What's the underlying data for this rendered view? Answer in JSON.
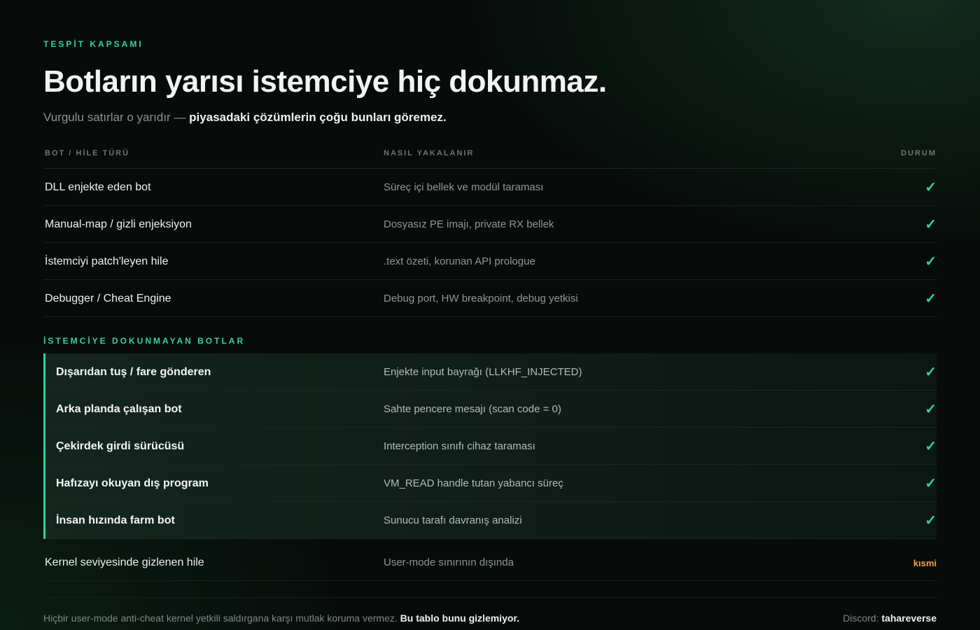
{
  "header": {
    "eyebrow": "TESPİT KAPSAMI",
    "title": "Botların yarısı istemciye hiç dokunmaz.",
    "subtitle_prefix": "Vurgulu satırlar o yarıdır — ",
    "subtitle_emphasis": "piyasadaki çözümlerin çoğu bunları göremez."
  },
  "table": {
    "headers": [
      "BOT / HİLE TÜRÜ",
      "NASIL YAKALANIR",
      "DURUM"
    ],
    "rows": [
      {
        "type": "DLL enjekte eden bot",
        "how": "Süreç içi bellek ve modül taraması",
        "status": "✓"
      },
      {
        "type": "Manual-map / gizli enjeksiyon",
        "how": "Dosyasız PE imajı, private RX bellek",
        "status": "✓"
      },
      {
        "type": "İstemciyi patch'leyen hile",
        "how": ".text özeti, korunan API prologue",
        "status": "✓"
      },
      {
        "type": "Debugger / Cheat Engine",
        "how": "Debug port, HW breakpoint, debug yetkisi",
        "status": "✓"
      }
    ],
    "section_label": "İSTEMCİYE DOKUNMAYAN BOTLAR",
    "highlight_rows": [
      {
        "type": "Dışarıdan tuş / fare gönderen",
        "how": "Enjekte input bayrağı (LLKHF_INJECTED)",
        "status": "✓"
      },
      {
        "type": "Arka planda çalışan bot",
        "how": "Sahte pencere mesajı (scan code = 0)",
        "status": "✓"
      },
      {
        "type": "Çekirdek girdi sürücüsü",
        "how": "Interception sınıfı cihaz taraması",
        "status": "✓"
      },
      {
        "type": "Hafızayı okuyan dış program",
        "how": "VM_READ handle tutan yabancı süreç",
        "status": "✓"
      },
      {
        "type": "İnsan hızında farm bot",
        "how": "Sunucu tarafı davranış analizi",
        "status": "✓"
      }
    ],
    "partial_row": {
      "type": "Kernel seviyesinde gizlenen hile",
      "how": "User-mode sınırının dışında",
      "status": "kısmi"
    }
  },
  "footer": {
    "note": "Hiçbir user-mode anti-cheat kernel yetkili saldırgana karşı mutlak koruma vermez. ",
    "note_emphasis": "Bu tablo bunu gizlemiyor.",
    "discord_label": "Discord: ",
    "discord_handle": "tahareverse"
  },
  "colors": {
    "accent": "#34d399",
    "partial": "#f59e42",
    "background": "#070c0a"
  }
}
